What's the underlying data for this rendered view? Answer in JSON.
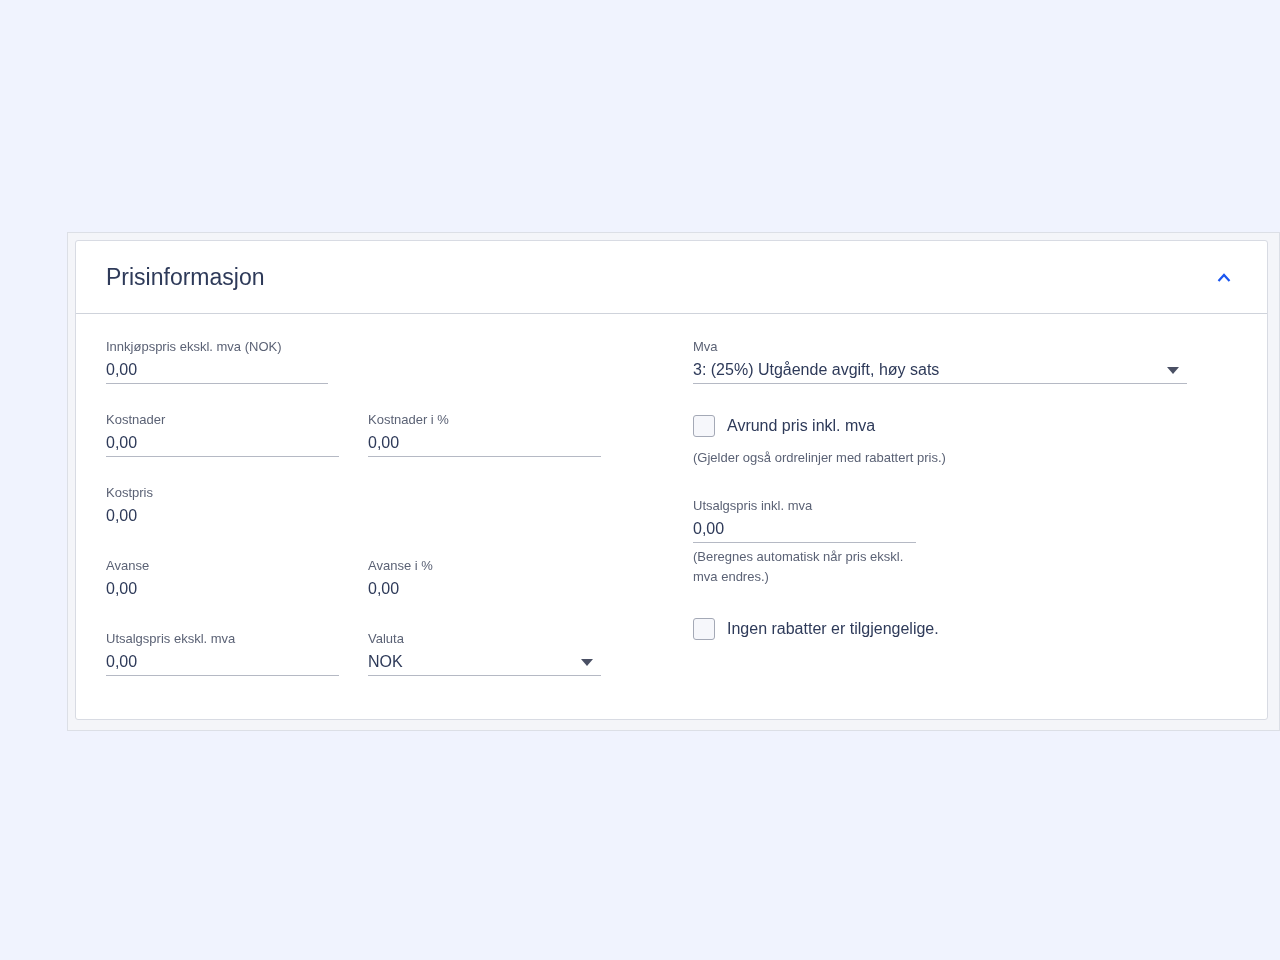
{
  "panel": {
    "title": "Prisinformasjon",
    "expanded": true
  },
  "left_rows": [
    [
      {
        "kind": "input",
        "label": "Innkjøpspris ekskl. mva (NOK)",
        "value": "0,00"
      }
    ],
    [
      {
        "kind": "input",
        "label": "Kostnader",
        "value": "0,00"
      },
      {
        "kind": "input",
        "label": "Kostnader i %",
        "value": "0,00"
      }
    ],
    [
      {
        "kind": "readonly",
        "label": "Kostpris",
        "value": "0,00"
      }
    ],
    [
      {
        "kind": "readonly",
        "label": "Avanse",
        "value": "0,00"
      },
      {
        "kind": "readonly",
        "label": "Avanse i %",
        "value": "0,00"
      }
    ],
    [
      {
        "kind": "input",
        "label": "Utsalgspris ekskl. mva",
        "value": "0,00"
      },
      {
        "kind": "select",
        "label": "Valuta",
        "value": "NOK"
      }
    ]
  ],
  "right_items": [
    {
      "kind": "select",
      "label": "Mva",
      "value": "3: (25%) Utgående avgift, høy sats"
    },
    {
      "kind": "checkbox",
      "label": "Avrund pris inkl. mva",
      "checked": false,
      "note": "(Gjelder også ordrelinjer med rabattert pris.)"
    },
    {
      "kind": "input",
      "label": "Utsalgspris inkl. mva",
      "value": "0,00",
      "note": "(Beregnes automatisk når pris ekskl. mva endres.)"
    },
    {
      "kind": "checkbox",
      "label": "Ingen rabatter er tilgjengelige.",
      "checked": false
    }
  ]
}
